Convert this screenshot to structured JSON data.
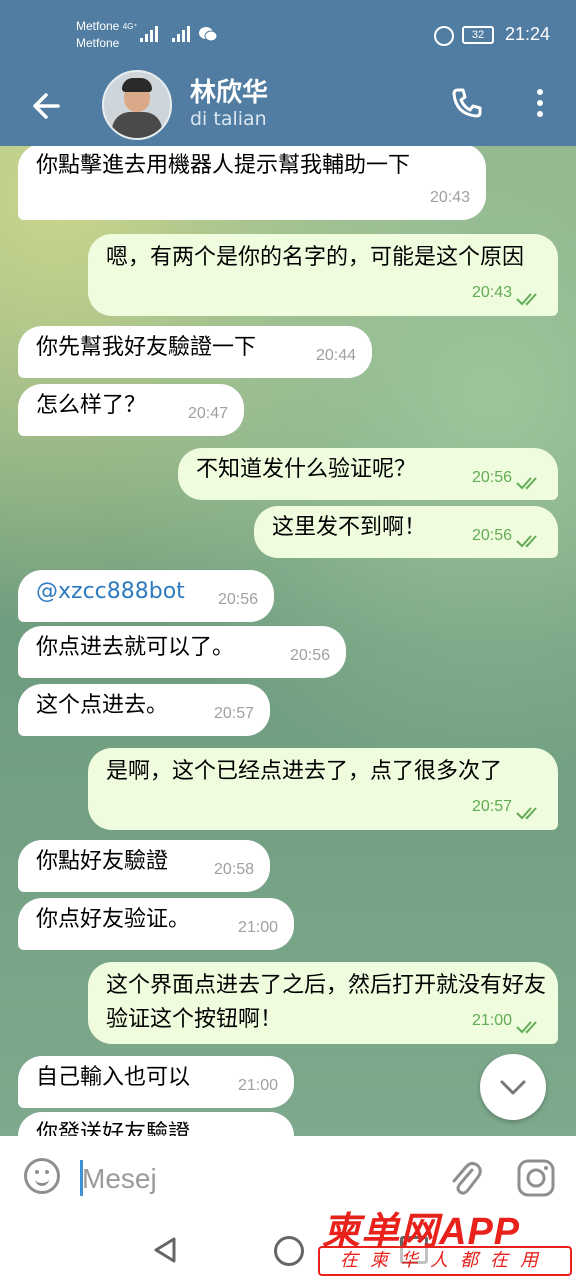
{
  "status_bar": {
    "carrier1": "Metfone",
    "carrier2": "Metfone",
    "network": "4G⁺",
    "battery": "32",
    "time": "21:24"
  },
  "header": {
    "title": "林欣华",
    "subtitle": "di talian"
  },
  "messages": [
    {
      "dir": "in",
      "text": "你點擊進去用機器人提示幫我輔助一下",
      "time": "20:43"
    },
    {
      "dir": "out",
      "text": "嗯，有两个是你的名字的，可能是这个原因",
      "time": "20:43"
    },
    {
      "dir": "in",
      "text": "你先幫我好友驗證一下",
      "time": "20:44"
    },
    {
      "dir": "in",
      "text": "怎么样了？",
      "time": "20:47"
    },
    {
      "dir": "out",
      "text": "不知道发什么验证呢？",
      "time": "20:56"
    },
    {
      "dir": "out",
      "text": "这里发不到啊！",
      "time": "20:56"
    },
    {
      "dir": "in",
      "text": "@xzcc888bot",
      "time": "20:56"
    },
    {
      "dir": "in",
      "text": "你点进去就可以了。",
      "time": "20:56"
    },
    {
      "dir": "in",
      "text": "这个点进去。",
      "time": "20:57"
    },
    {
      "dir": "out",
      "text": "是啊，这个已经点进去了，点了很多次了",
      "time": "20:57"
    },
    {
      "dir": "in",
      "text": "你點好友驗證",
      "time": "20:58"
    },
    {
      "dir": "in",
      "text": "你点好友验证。",
      "time": "21:00"
    },
    {
      "dir": "out",
      "text": "这个界面点进去了之后，然后打开就没有好友验证这个按钮啊！",
      "time": "21:00"
    },
    {
      "dir": "in",
      "text": "自己輸入也可以",
      "time": "21:00"
    },
    {
      "dir": "in",
      "text": "你發送好友驗證",
      "time": ""
    }
  ],
  "composer": {
    "placeholder": "Mesej"
  },
  "watermark": {
    "top": "柬单网APP",
    "bottom": "在柬华人都在用"
  },
  "icons": {
    "back": "arrow-left-icon",
    "call": "phone-icon",
    "more": "more-vertical-icon",
    "emoji": "emoji-icon",
    "attach": "paperclip-icon",
    "camera": "camera-icon",
    "scroll": "chevron-down-icon"
  },
  "colors": {
    "header": "#517da2",
    "incoming": "#ffffff",
    "outgoing": "#effdde",
    "time_outgoing": "#62ac55"
  }
}
